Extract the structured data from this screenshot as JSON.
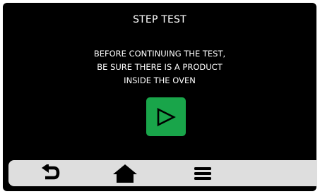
{
  "header": {
    "title": "STEP TEST"
  },
  "message": {
    "line1": "BEFORE CONTINUING THE TEST,",
    "line2": "BE SURE THERE IS A PRODUCT",
    "line3": "INSIDE THE OVEN"
  },
  "play_button": {
    "icon": "play-icon",
    "color": "#19a54a"
  },
  "bottom_bar": {
    "background": "#dedede",
    "items": [
      {
        "icon": "back-arrow-icon"
      },
      {
        "icon": "home-icon"
      },
      {
        "icon": "menu-icon"
      }
    ]
  }
}
